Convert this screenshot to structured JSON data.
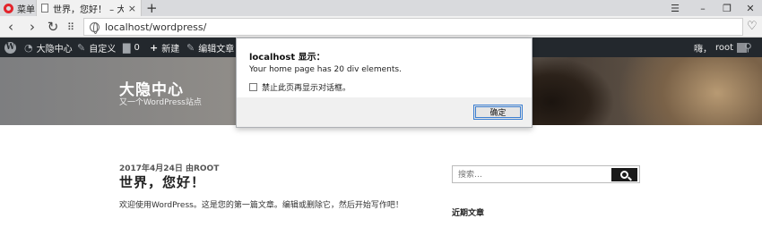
{
  "browser": {
    "menu_label": "菜单",
    "tab_title": "世界，您好！ – 大隐中心",
    "tab_close": "×",
    "new_tab": "+",
    "url": "localhost/wordpress/"
  },
  "adminbar": {
    "site_name": "大隐中心",
    "customize": "自定义",
    "comments_count": "0",
    "new": "新建",
    "edit_post": "编辑文章",
    "greeting_prefix": "嗨，",
    "user": "root"
  },
  "site": {
    "title": "大隐中心",
    "description": "又一个WordPress站点"
  },
  "post": {
    "meta": "2017年4月24日 由ROOT",
    "title": "世界，您好！",
    "excerpt": "欢迎使用WordPress。这是您的第一篇文章。编辑或删除它，然后开始写作吧！"
  },
  "sidebar": {
    "search_placeholder": "搜索…",
    "recent_posts_heading": "近期文章"
  },
  "dialog": {
    "title": "localhost 显示：",
    "message": "Your home page has 20 div elements.",
    "checkbox_label": "禁止此页再显示对话框。",
    "ok_label": "确定"
  },
  "colors": {
    "admin_bar": "#23282d",
    "opera_red": "#e3242b",
    "button_focus": "#3c7fd1"
  }
}
